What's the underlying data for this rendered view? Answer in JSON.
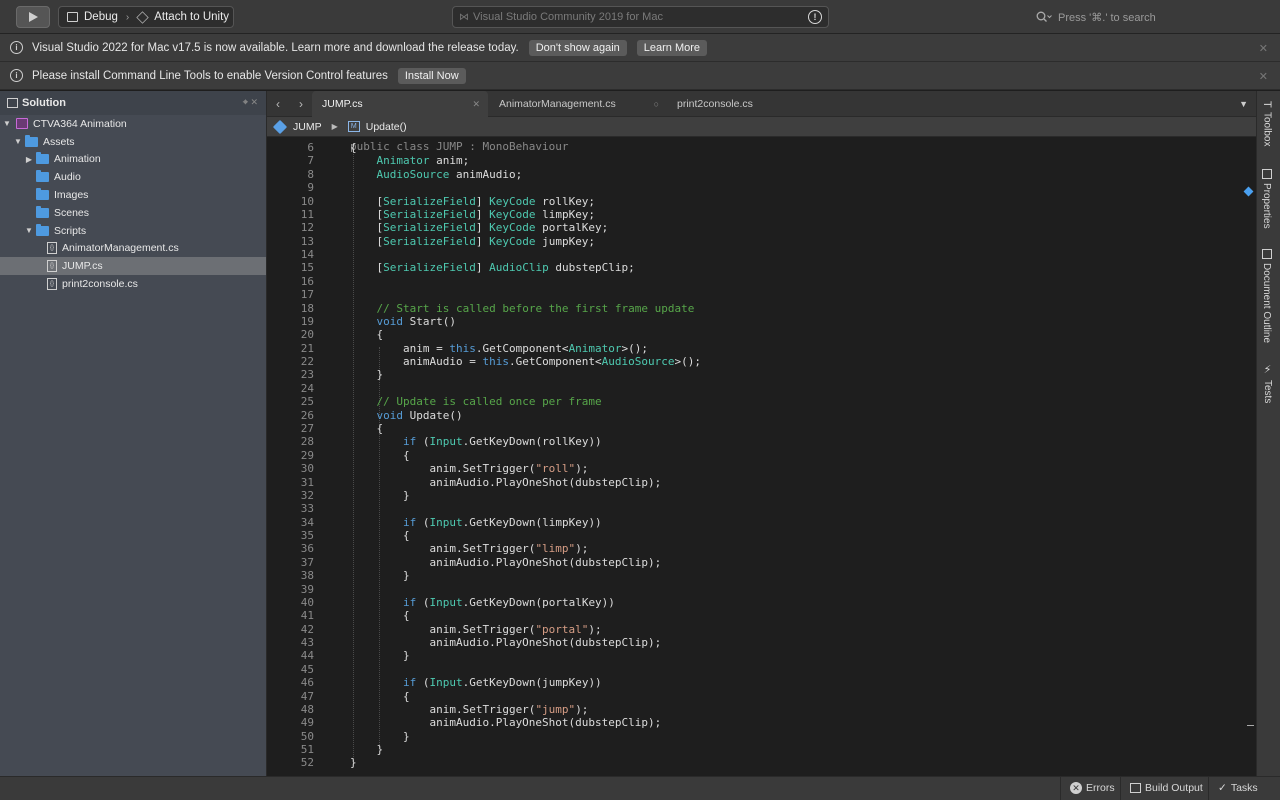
{
  "toolbar": {
    "config": "Debug",
    "target": "Attach to Unity",
    "status": "Visual Studio Community 2019 for Mac",
    "search_placeholder": "Press '⌘.' to search"
  },
  "infobars": [
    {
      "message": "Visual Studio 2022 for Mac v17.5 is now available. Learn more and download the release today.",
      "buttons": [
        "Don't show again",
        "Learn More"
      ]
    },
    {
      "message": "Please install Command Line Tools to enable Version Control features",
      "buttons": [
        "Install Now"
      ]
    }
  ],
  "sidebar": {
    "title": "Solution",
    "project": "CTVA364 Animation",
    "items": [
      {
        "label": "Assets",
        "type": "folder",
        "level": 1,
        "arrow": "▼"
      },
      {
        "label": "Animation",
        "type": "folder",
        "level": 2,
        "arrow": "▶"
      },
      {
        "label": "Audio",
        "type": "folder",
        "level": 2,
        "arrow": ""
      },
      {
        "label": "Images",
        "type": "folder",
        "level": 2,
        "arrow": ""
      },
      {
        "label": "Scenes",
        "type": "folder",
        "level": 2,
        "arrow": ""
      },
      {
        "label": "Scripts",
        "type": "folder",
        "level": 2,
        "arrow": "▼"
      },
      {
        "label": "AnimatorManagement.cs",
        "type": "file",
        "level": 3,
        "arrow": ""
      },
      {
        "label": "JUMP.cs",
        "type": "file",
        "level": 3,
        "arrow": "",
        "selected": true
      },
      {
        "label": "print2console.cs",
        "type": "file",
        "level": 3,
        "arrow": ""
      }
    ]
  },
  "tabs": [
    {
      "label": "JUMP.cs",
      "active": true
    },
    {
      "label": "AnimatorManagement.cs",
      "active": false
    },
    {
      "label": "print2console.cs",
      "active": false
    }
  ],
  "navbar": {
    "class_name": "JUMP",
    "method_name": "Update()"
  },
  "code": [
    {
      "n": "6",
      "t": "{"
    },
    {
      "n": "7",
      "t": "    Animator anim;"
    },
    {
      "n": "8",
      "t": "    AudioSource animAudio;"
    },
    {
      "n": "9",
      "t": ""
    },
    {
      "n": "10",
      "t": "    [SerializeField] KeyCode rollKey;"
    },
    {
      "n": "11",
      "t": "    [SerializeField] KeyCode limpKey;"
    },
    {
      "n": "12",
      "t": "    [SerializeField] KeyCode portalKey;"
    },
    {
      "n": "13",
      "t": "    [SerializeField] KeyCode jumpKey;"
    },
    {
      "n": "14",
      "t": ""
    },
    {
      "n": "15",
      "t": "    [SerializeField] AudioClip dubstepClip;"
    },
    {
      "n": "16",
      "t": ""
    },
    {
      "n": "17",
      "t": ""
    },
    {
      "n": "18",
      "t": "    // Start is called before the first frame update"
    },
    {
      "n": "19",
      "t": "    void Start()"
    },
    {
      "n": "20",
      "t": "    {"
    },
    {
      "n": "21",
      "t": "        anim = this.GetComponent<Animator>();"
    },
    {
      "n": "22",
      "t": "        animAudio = this.GetComponent<AudioSource>();"
    },
    {
      "n": "23",
      "t": "    }"
    },
    {
      "n": "24",
      "t": ""
    },
    {
      "n": "25",
      "t": "    // Update is called once per frame"
    },
    {
      "n": "26",
      "t": "    void Update()"
    },
    {
      "n": "27",
      "t": "    {"
    },
    {
      "n": "28",
      "t": "        if (Input.GetKeyDown(rollKey))"
    },
    {
      "n": "29",
      "t": "        {"
    },
    {
      "n": "30",
      "t": "            anim.SetTrigger(\"roll\");"
    },
    {
      "n": "31",
      "t": "            animAudio.PlayOneShot(dubstepClip);"
    },
    {
      "n": "32",
      "t": "        }"
    },
    {
      "n": "33",
      "t": ""
    },
    {
      "n": "34",
      "t": "        if (Input.GetKeyDown(limpKey))"
    },
    {
      "n": "35",
      "t": "        {"
    },
    {
      "n": "36",
      "t": "            anim.SetTrigger(\"limp\");"
    },
    {
      "n": "37",
      "t": "            animAudio.PlayOneShot(dubstepClip);"
    },
    {
      "n": "38",
      "t": "        }"
    },
    {
      "n": "39",
      "t": ""
    },
    {
      "n": "40",
      "t": "        if (Input.GetKeyDown(portalKey))"
    },
    {
      "n": "41",
      "t": "        {"
    },
    {
      "n": "42",
      "t": "            anim.SetTrigger(\"portal\");"
    },
    {
      "n": "43",
      "t": "            animAudio.PlayOneShot(dubstepClip);"
    },
    {
      "n": "44",
      "t": "        }"
    },
    {
      "n": "45",
      "t": ""
    },
    {
      "n": "46",
      "t": "        if (Input.GetKeyDown(jumpKey))"
    },
    {
      "n": "47",
      "t": "        {"
    },
    {
      "n": "48",
      "t": "            anim.SetTrigger(\"jump\");"
    },
    {
      "n": "49",
      "t": "            animAudio.PlayOneShot(dubstepClip);"
    },
    {
      "n": "50",
      "t": "        }"
    },
    {
      "n": "51",
      "t": "    }"
    },
    {
      "n": "52",
      "t": "}"
    }
  ],
  "right_dock": [
    "Toolbox",
    "Properties",
    "Document Outline",
    "Tests"
  ],
  "statusbar": {
    "errors": "Errors",
    "build_output": "Build Output",
    "tasks": "Tasks"
  },
  "colors": {
    "keyword": "#569cd6",
    "type": "#4ec9b0",
    "comment": "#57a64a",
    "string": "#d69d85",
    "folder": "#4e9ae0"
  }
}
